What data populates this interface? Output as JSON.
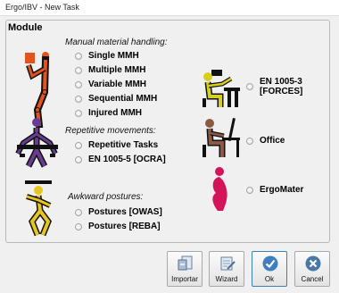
{
  "window": {
    "title": "Ergo/IBV - New Task"
  },
  "module": {
    "title": "Module"
  },
  "sections": {
    "mmh": {
      "label": "Manual material handling:",
      "options": [
        "Single MMH",
        "Multiple MMH",
        "Variable MMH",
        "Sequential MMH",
        "Injured MMH"
      ]
    },
    "repetitive": {
      "label": "Repetitive movements:",
      "options": [
        "Repetitive Tasks",
        "EN 1005-5 [OCRA]"
      ]
    },
    "awkward": {
      "label": "Awkward postures:",
      "options": [
        "Postures [OWAS]",
        "Postures [REBA]"
      ]
    },
    "forces": {
      "option_line1": "EN 1005-3",
      "option_line2": "[FORCES]"
    },
    "office": {
      "option": "Office"
    },
    "ergomater": {
      "option": "ErgoMater"
    }
  },
  "buttons": {
    "import": "Importar",
    "wizard": "Wizard",
    "ok": "Ok",
    "cancel": "Cancel"
  },
  "colors": {
    "accent": "#3d7fbf",
    "mmh_figure": "#e2531e",
    "repetitive_figure": "#6a3c91",
    "awkward_figure": "#e6c51f",
    "forces_figure": "#d8cf1d",
    "office_figure": "#8c5a44",
    "ergomater_figure": "#d4145a"
  },
  "icons": {
    "import": "import-document-icon",
    "wizard": "wizard-wand-icon",
    "ok": "checkmark-icon",
    "cancel": "cross-icon"
  }
}
